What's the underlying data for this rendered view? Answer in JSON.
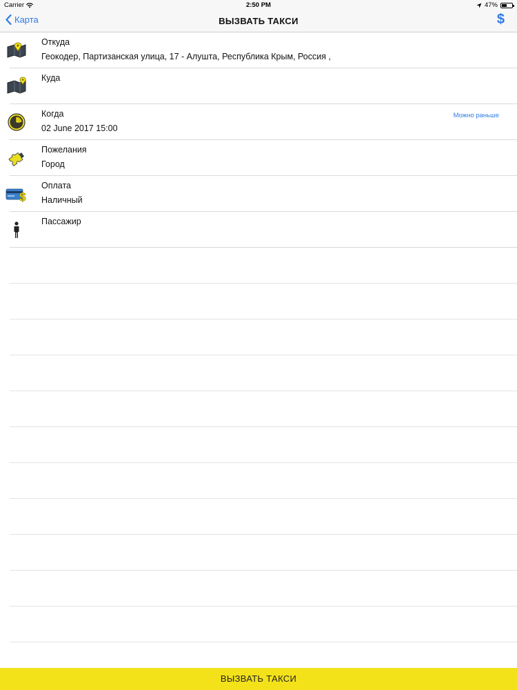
{
  "status_bar": {
    "carrier": "Carrier",
    "time": "2:50 PM",
    "battery": "47%",
    "battery_level": 0.47
  },
  "nav": {
    "back_label": "Карта",
    "title": "ВЫЗВАТЬ ТАКСИ",
    "dollar_symbol": "$"
  },
  "rows": [
    {
      "label": "Откуда",
      "value": "Геокодер, Партизанская улица, 17 - Алушта, Республика Крым, Россия ,",
      "icon": "map-pin-from-icon"
    },
    {
      "label": "Куда",
      "value": "",
      "icon": "map-pin-to-icon"
    },
    {
      "label": "Когда",
      "value": "02 June 2017 15:00",
      "extra": "Можно раньше",
      "icon": "clock-icon"
    },
    {
      "label": "Пожелания",
      "value": "Город",
      "icon": "puzzle-icon"
    },
    {
      "label": "Оплата",
      "value": "Наличный",
      "icon": "payment-card-icon"
    },
    {
      "label": "Пассажир",
      "value": "",
      "icon": "person-icon"
    }
  ],
  "call_button_label": "ВЫЗВАТЬ ТАКСИ",
  "colors": {
    "accent": "#2f7ae5",
    "button_yellow": "#f3e21a"
  }
}
